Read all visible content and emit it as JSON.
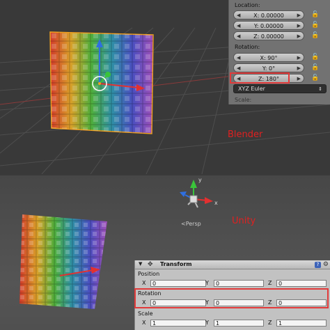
{
  "blender": {
    "location_label": "Location:",
    "location": {
      "x": "X: 0.00000",
      "y": "Y: 0.00000",
      "z": "Z: 0.00000"
    },
    "rotation_label": "Rotation:",
    "rotation": {
      "x": "X: 90°",
      "y": "Y: 0°",
      "z": "Z: 180°"
    },
    "rotation_mode": "XYZ Euler",
    "scale_label": "Scale:",
    "caption": "Blender"
  },
  "unity": {
    "persp_label": "<Persp",
    "gizmo_y": "y",
    "gizmo_x": "x",
    "caption": "Unity",
    "transform_title": "Transform",
    "position_label": "Position",
    "rotation_label": "Rotation",
    "scale_label": "Scale",
    "axis_labels": {
      "x": "X",
      "y": "Y",
      "z": "Z"
    },
    "position": {
      "x": "0",
      "y": "0",
      "z": "0"
    },
    "rotation": {
      "x": "0",
      "y": "0",
      "z": "0"
    },
    "scale": {
      "x": "1",
      "y": "1",
      "z": "1"
    }
  },
  "icons": {
    "lock": "lock-icon",
    "help": "help-icon",
    "gear": "gear-icon",
    "transform": "transform-icon"
  },
  "colors": {
    "highlight": "#e23a3a",
    "caption": "#e02020",
    "x_axis": "#e23030",
    "y_axis": "#3ac43a",
    "z_axis": "#2f6fe0"
  }
}
